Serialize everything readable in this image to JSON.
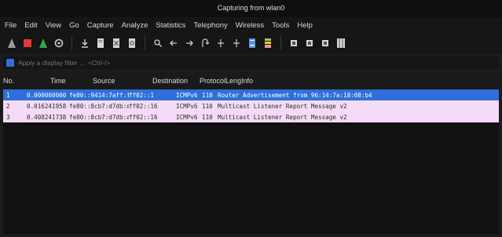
{
  "window": {
    "title": "Capturing from wlan0"
  },
  "menu": [
    "File",
    "Edit",
    "View",
    "Go",
    "Capture",
    "Analyze",
    "Statistics",
    "Telephony",
    "Wireless",
    "Tools",
    "Help"
  ],
  "filter": {
    "placeholder": "Apply a display filter … <Ctrl-/>"
  },
  "columns": [
    "No.",
    "Time",
    "Source",
    "Destination",
    "Protocol",
    "Length",
    "Info"
  ],
  "packets": [
    {
      "no": "1",
      "time": "0.000000000",
      "source": "fe80::9414:7aff:fe1…",
      "destination": "ff02::1",
      "protocol": "ICMPv6",
      "length": "110",
      "info": "Router Advertisement from 96:14:7a:18:08:b4"
    },
    {
      "no": "2",
      "time": "0.016241958",
      "source": "fe80::8cb7:d7db:a6b…",
      "destination": "ff02::16",
      "protocol": "ICMPv6",
      "length": "110",
      "info": "Multicast Listener Report Message v2"
    },
    {
      "no": "3",
      "time": "0.408241738",
      "source": "fe80::8cb7:d7db:a6b…",
      "destination": "ff02::16",
      "protocol": "ICMPv6",
      "length": "110",
      "info": "Multicast Listener Report Message v2"
    }
  ],
  "colors": {
    "selected_row": "#2f6fdb",
    "icmp_row": "#f4dbf7"
  },
  "toolbar_icons": [
    "shark-fin-start-icon",
    "stop-capture-icon",
    "restart-capture-icon",
    "capture-options-icon",
    "open-file-icon",
    "save-file-icon",
    "close-file-icon",
    "reload-icon",
    "find-packet-icon",
    "go-back-icon",
    "go-forward-icon",
    "go-to-packet-icon",
    "go-first-icon",
    "go-last-icon",
    "autoscroll-icon",
    "colorize-icon",
    "zoom-in-icon",
    "zoom-out-icon",
    "normal-size-icon",
    "resize-columns-icon"
  ]
}
